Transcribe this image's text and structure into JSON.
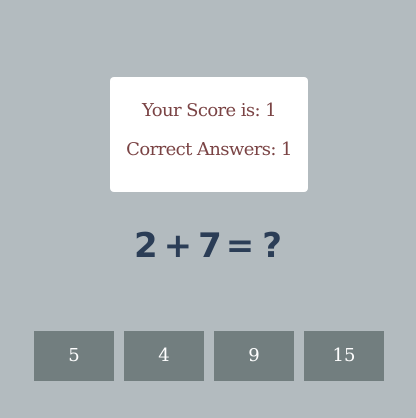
{
  "score_card": {
    "score_text": "Your Score is: 1",
    "correct_text": "Correct Answers: 1"
  },
  "question": {
    "left_operand": "2",
    "operator": "+",
    "right_operand": "7",
    "equals": "=",
    "unknown": "?"
  },
  "answers": [
    {
      "label": "5"
    },
    {
      "label": "4"
    },
    {
      "label": "9"
    },
    {
      "label": "15"
    }
  ],
  "colors": {
    "background": "#b3bbbf",
    "card": "#ffffff",
    "score_text": "#7a4344",
    "question_text": "#2b3d56",
    "answer_button": "#727e7f",
    "answer_text": "#ffffff"
  }
}
